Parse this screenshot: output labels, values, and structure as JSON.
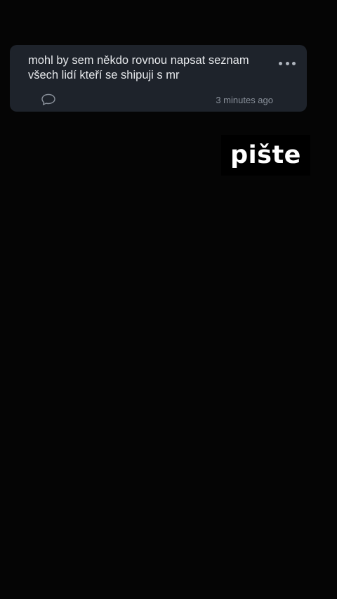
{
  "question": {
    "text": "mohl by sem někdo rovnou napsat seznam všech lidí kteří se shipuji s mr",
    "timestamp": "3 minutes ago",
    "more_icon": "more-dots-icon",
    "reply_icon": "speech-bubble-icon"
  },
  "sticker": {
    "text": "pište"
  },
  "colors": {
    "background": "#050505",
    "card": "#1e232b",
    "card_text": "#e6e8eb",
    "muted_text": "#8a919b",
    "sticker_text": "#ffffff"
  }
}
